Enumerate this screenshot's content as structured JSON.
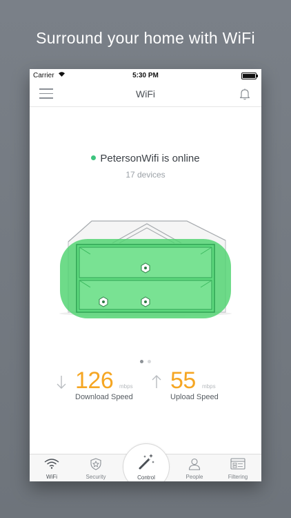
{
  "headline": "Surround your home with WiFi",
  "status_bar": {
    "carrier": "Carrier",
    "time": "5:30 PM"
  },
  "nav": {
    "title": "WiFi"
  },
  "network": {
    "name_status": "PetersonWifi is online",
    "devices": "17 devices",
    "status_color": "#3dc47e"
  },
  "pager": {
    "count": 2,
    "active_index": 0
  },
  "speeds": {
    "download": {
      "value": "126",
      "unit": "mbps",
      "label": "Download Speed"
    },
    "upload": {
      "value": "55",
      "unit": "mbps",
      "label": "Upload Speed"
    }
  },
  "tabs": {
    "wifi": {
      "label": "WiFi",
      "icon": "wifi-icon"
    },
    "security": {
      "label": "Security",
      "icon": "shield-icon"
    },
    "control": {
      "label": "Control",
      "icon": "magic-wand-icon"
    },
    "people": {
      "label": "People",
      "icon": "person-icon"
    },
    "filtering": {
      "label": "Filtering",
      "icon": "filter-icon"
    }
  },
  "colors": {
    "accent_speed": "#f5a623",
    "coverage_green": "#4ed36f",
    "background": "#71777e"
  }
}
